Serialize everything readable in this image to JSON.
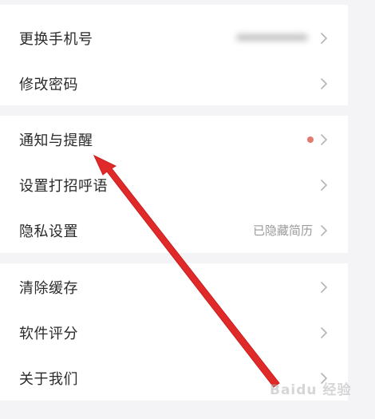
{
  "colors": {
    "background": "#f4f4f6",
    "panel": "#ffffff",
    "text": "#2a2a2a",
    "secondary_text": "#9a9a9a",
    "chevron": "#b4b4b4",
    "notification_dot": "#e27a6e",
    "annotation_arrow": "#e02a2a"
  },
  "groups": [
    {
      "items": [
        {
          "label": "更换手机号",
          "value": "",
          "value_blurred": true,
          "chevron_icon": "chevron-right-icon"
        },
        {
          "label": "修改密码",
          "value": "",
          "chevron_icon": "chevron-right-icon"
        }
      ]
    },
    {
      "items": [
        {
          "label": "通知与提醒",
          "has_dot": true,
          "chevron_icon": "chevron-right-icon"
        },
        {
          "label": "设置打招呼语",
          "chevron_icon": "chevron-right-icon"
        },
        {
          "label": "隐私设置",
          "value": "已隐藏简历",
          "chevron_icon": "chevron-right-icon"
        }
      ]
    },
    {
      "items": [
        {
          "label": "清除缓存",
          "chevron_icon": "chevron-right-icon"
        },
        {
          "label": "软件评分",
          "chevron_icon": "chevron-right-icon"
        },
        {
          "label": "关于我们",
          "chevron_icon": "chevron-right-icon"
        }
      ]
    }
  ],
  "watermark": "Baidu 经验"
}
